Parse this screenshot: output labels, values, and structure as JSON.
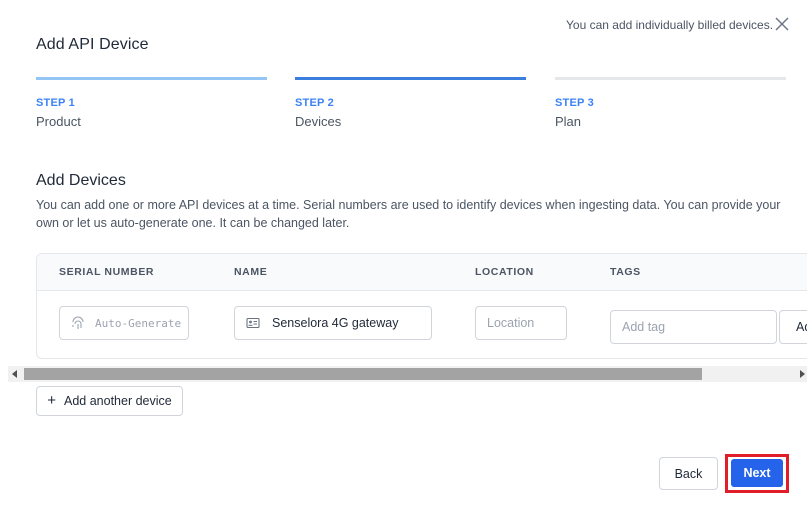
{
  "dialog": {
    "title": "Add API Device",
    "hint": "You can add individually billed devices."
  },
  "steps": [
    {
      "label": "STEP 1",
      "name": "Product",
      "bar_color": "#93c5f5",
      "label_color": "#3b82f6"
    },
    {
      "label": "STEP 2",
      "name": "Devices",
      "bar_color": "#3b7ddd",
      "label_color": "#3b82f6"
    },
    {
      "label": "STEP 3",
      "name": "Plan",
      "bar_color": "#e5e7eb",
      "label_color": "#3b82f6"
    }
  ],
  "section": {
    "title": "Add Devices",
    "description": "You can add one or more API devices at a time. Serial numbers are used to identify devices when ingesting data. You can provide your own or let us auto-generate one. It can be changed later."
  },
  "table": {
    "headers": [
      "SERIAL NUMBER",
      "NAME",
      "LOCATION",
      "TAGS"
    ],
    "row": {
      "serial_placeholder": "Auto-Generate",
      "serial_icon": "fingerprint-icon",
      "name_value": "Senselora 4G gateway",
      "name_icon": "id-card-icon",
      "location_placeholder": "Location",
      "tag_placeholder": "Add tag",
      "tag_button_label": "Ad"
    }
  },
  "buttons": {
    "add_device": "Add another device",
    "back": "Back",
    "next": "Next"
  },
  "colors": {
    "primary": "#2563eb",
    "highlight": "#e11d2a"
  }
}
